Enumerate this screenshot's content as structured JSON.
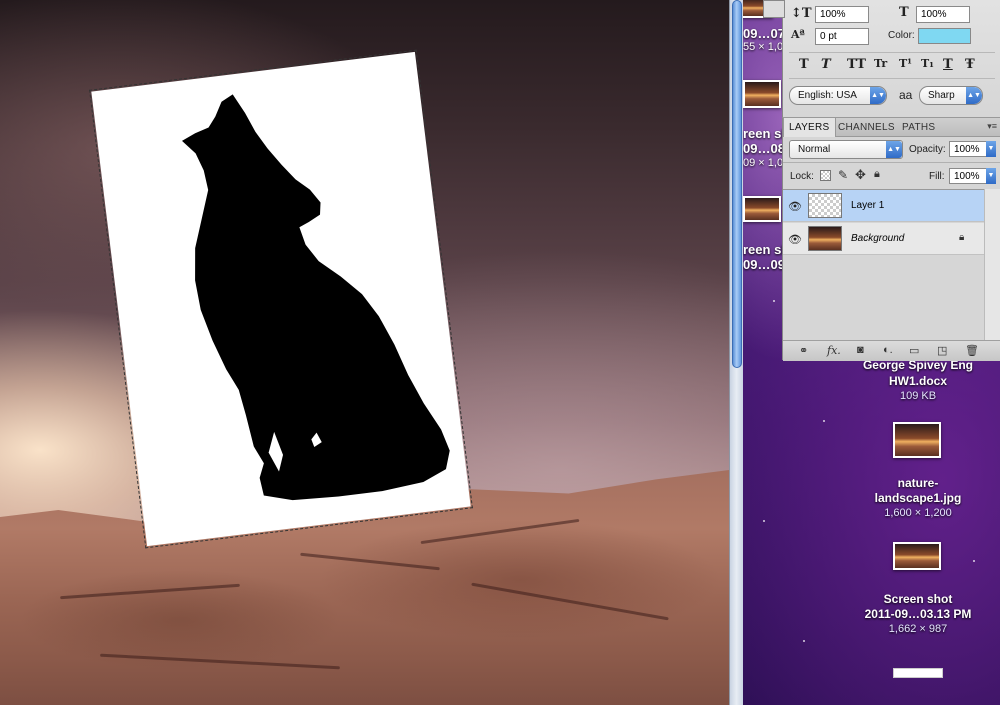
{
  "character_panel": {
    "vertical_scale": "100%",
    "horizontal_scale": "100%",
    "baseline_shift": "0 pt",
    "color_label": "Color:",
    "color_swatch": "#7fd8f2",
    "style_buttons": [
      "T",
      "T",
      "TT",
      "Tr",
      "T¹",
      "T₁",
      "T",
      "Ŧ"
    ],
    "language": "English: USA",
    "aa_icon": "aa",
    "antialias": "Sharp"
  },
  "layers_panel": {
    "tabs": [
      "LAYERS",
      "CHANNELS",
      "PATHS"
    ],
    "blend_mode": "Normal",
    "opacity_label": "Opacity:",
    "opacity": "100%",
    "lock_label": "Lock:",
    "fill_label": "Fill:",
    "fill": "100%",
    "layers": [
      {
        "name": "Layer 1",
        "selected": true
      },
      {
        "name": "Background",
        "selected": false,
        "locked": true
      }
    ],
    "footer_icons": [
      "link-icon",
      "fx-icon",
      "mask-icon",
      "adjustment-icon",
      "group-icon",
      "new-layer-icon",
      "trash-icon"
    ]
  },
  "desktop": {
    "partial_labels": [
      "09…07",
      "55 × 1,0",
      "reen sh",
      "09…08",
      "09 × 1,0",
      "reen sh",
      "09…09"
    ],
    "files": [
      {
        "name_line1": "George Spivey Eng",
        "name_line2": "HW1.docx",
        "meta": "109 KB"
      },
      {
        "name_line1": "nature-",
        "name_line2": "landscape1.jpg",
        "meta": "1,600 × 1,200"
      },
      {
        "name_line1": "Screen shot",
        "name_line2": "2011-09…03.13 PM",
        "meta": "1,662 × 987"
      }
    ]
  }
}
